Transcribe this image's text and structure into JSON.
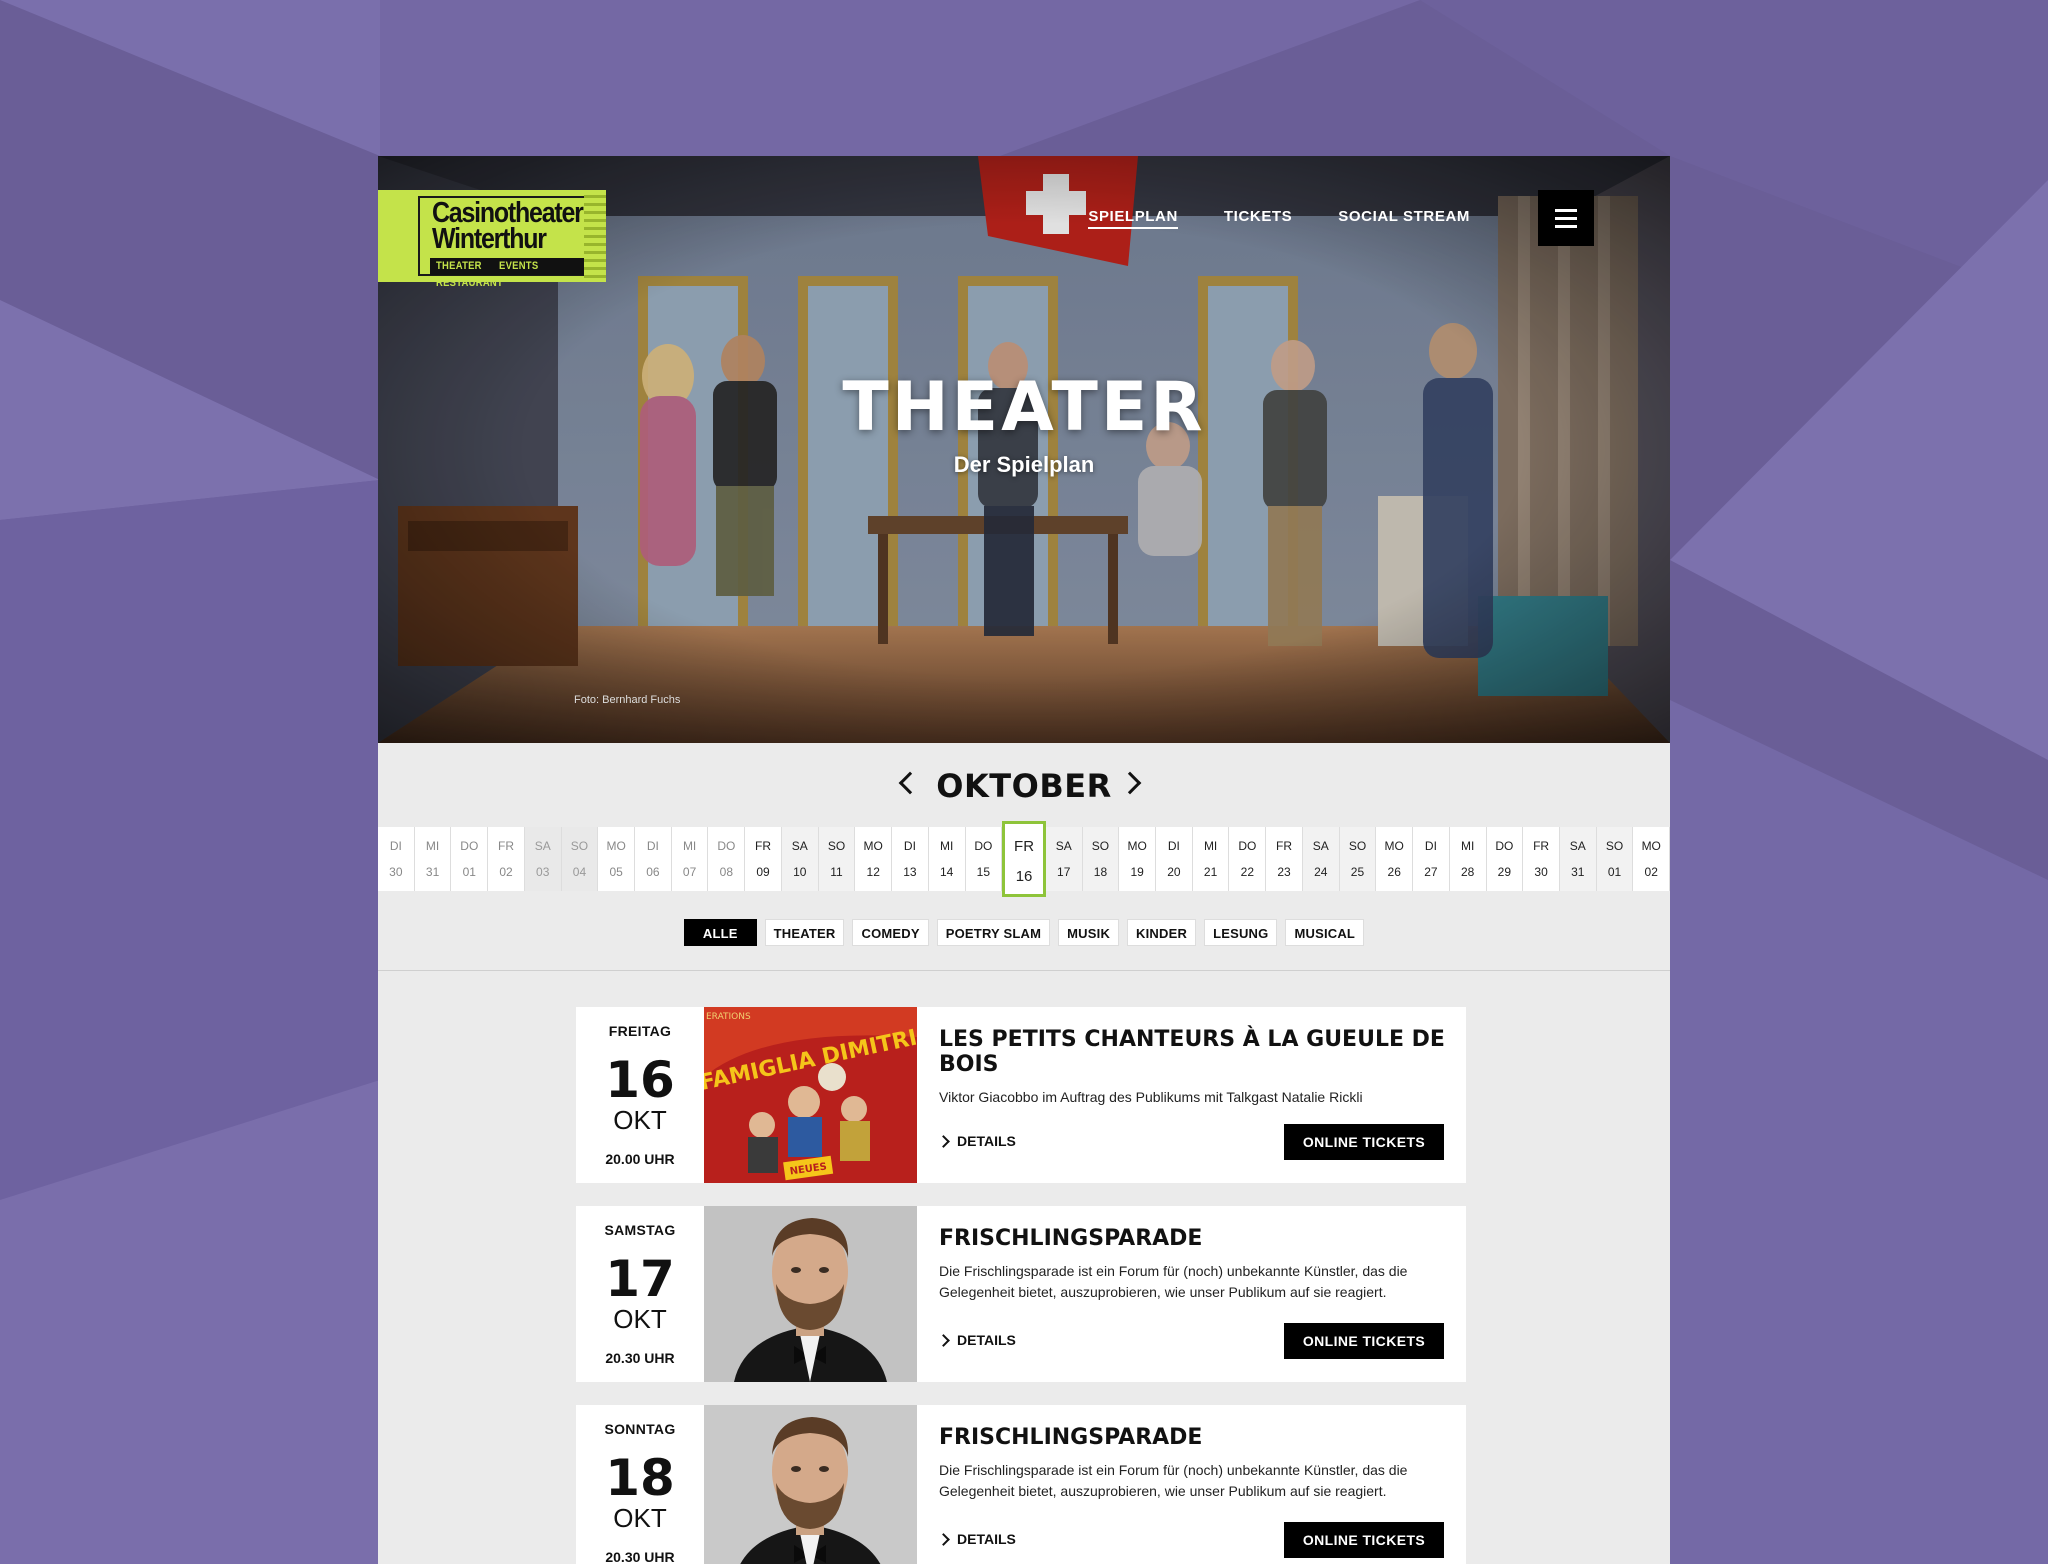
{
  "nav": {
    "items": [
      "SPIELPLAN",
      "TICKETS",
      "SOCIAL STREAM"
    ],
    "active": "SPIELPLAN"
  },
  "logo": {
    "line1": "Casinotheater",
    "line2": "Winterthur",
    "tags": [
      "THEATER",
      "EVENTS",
      "RESTAURANT"
    ],
    "color": "#c4e34a"
  },
  "hero": {
    "title": "THEATER",
    "subtitle": "Der Spielplan",
    "photo_credit": "Foto: Bernhard Fuchs"
  },
  "calendar": {
    "month": "OKTOBER",
    "days": [
      {
        "wd": "DI",
        "d": "30",
        "state": "past"
      },
      {
        "wd": "MI",
        "d": "31",
        "state": "past"
      },
      {
        "wd": "DO",
        "d": "01",
        "state": "past"
      },
      {
        "wd": "FR",
        "d": "02",
        "state": "past"
      },
      {
        "wd": "SA",
        "d": "03",
        "state": "past-wk"
      },
      {
        "wd": "SO",
        "d": "04",
        "state": "past-wk"
      },
      {
        "wd": "MO",
        "d": "05",
        "state": "past"
      },
      {
        "wd": "DI",
        "d": "06",
        "state": "past"
      },
      {
        "wd": "MI",
        "d": "07",
        "state": "past"
      },
      {
        "wd": "DO",
        "d": "08",
        "state": "past"
      },
      {
        "wd": "FR",
        "d": "09",
        "state": ""
      },
      {
        "wd": "SA",
        "d": "10",
        "state": "wk"
      },
      {
        "wd": "SO",
        "d": "11",
        "state": "wk"
      },
      {
        "wd": "MO",
        "d": "12",
        "state": ""
      },
      {
        "wd": "DI",
        "d": "13",
        "state": ""
      },
      {
        "wd": "MI",
        "d": "14",
        "state": ""
      },
      {
        "wd": "DO",
        "d": "15",
        "state": ""
      },
      {
        "wd": "FR",
        "d": "16",
        "state": "selected"
      },
      {
        "wd": "SA",
        "d": "17",
        "state": "wk"
      },
      {
        "wd": "SO",
        "d": "18",
        "state": "wk"
      },
      {
        "wd": "MO",
        "d": "19",
        "state": ""
      },
      {
        "wd": "DI",
        "d": "20",
        "state": ""
      },
      {
        "wd": "MI",
        "d": "21",
        "state": ""
      },
      {
        "wd": "DO",
        "d": "22",
        "state": ""
      },
      {
        "wd": "FR",
        "d": "23",
        "state": ""
      },
      {
        "wd": "SA",
        "d": "24",
        "state": "wk"
      },
      {
        "wd": "SO",
        "d": "25",
        "state": "wk"
      },
      {
        "wd": "MO",
        "d": "26",
        "state": ""
      },
      {
        "wd": "DI",
        "d": "27",
        "state": ""
      },
      {
        "wd": "MI",
        "d": "28",
        "state": ""
      },
      {
        "wd": "DO",
        "d": "29",
        "state": ""
      },
      {
        "wd": "FR",
        "d": "30",
        "state": ""
      },
      {
        "wd": "SA",
        "d": "31",
        "state": "wk"
      },
      {
        "wd": "SO",
        "d": "01",
        "state": "wk"
      },
      {
        "wd": "MO",
        "d": "02",
        "state": ""
      }
    ]
  },
  "filters": {
    "items": [
      "ALLE",
      "THEATER",
      "COMEDY",
      "POETRY SLAM",
      "MUSIK",
      "KINDER",
      "LESUNG",
      "MUSICAL"
    ],
    "active": "ALLE"
  },
  "events": [
    {
      "weekday": "FREITAG",
      "day": "16",
      "month": "OKT",
      "time": "20.00 UHR",
      "title": "LES PETITS CHANTEURS À LA GUEULE DE BOIS",
      "description": "Viktor Giacobbo im Auftrag des Publikums mit Talkgast Natalie Rickli",
      "details_label": "DETAILS",
      "tickets_label": "ONLINE TICKETS",
      "poster_text": "FAMIGLIA DIMITRI",
      "poster_badge": "NEUES",
      "poster_corner": "ERATIONS"
    },
    {
      "weekday": "SAMSTAG",
      "day": "17",
      "month": "OKT",
      "time": "20.30 UHR",
      "title": "FRISCHLINGSPARADE",
      "description": "Die Frischlingsparade ist ein Forum für (noch) unbekannte Künstler, das die Gelegenheit bietet, auszuprobieren, wie unser Publikum auf sie reagiert.",
      "details_label": "DETAILS",
      "tickets_label": "ONLINE TICKETS"
    },
    {
      "weekday": "SONNTAG",
      "day": "18",
      "month": "OKT",
      "time": "20.30 UHR",
      "title": "FRISCHLINGSPARADE",
      "description": "Die Frischlingsparade ist ein Forum für (noch) unbekannte Künstler, das die Gelegenheit bietet, auszuprobieren, wie unser Publikum auf sie reagiert.",
      "details_label": "DETAILS",
      "tickets_label": "ONLINE TICKETS"
    }
  ],
  "colors": {
    "background": "#6b5f98",
    "accent": "#8ec43a",
    "button": "#000000"
  }
}
